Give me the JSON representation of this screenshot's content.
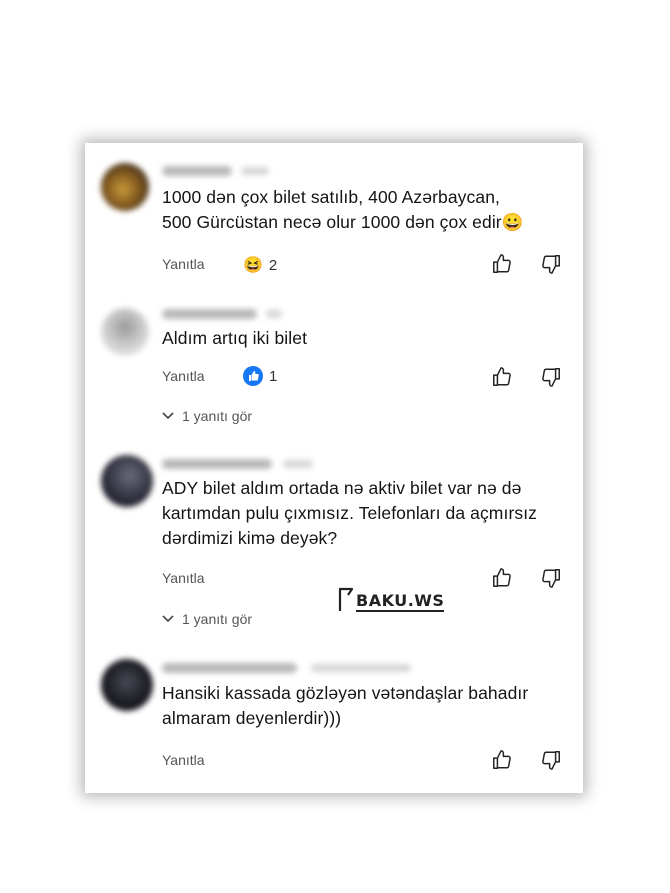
{
  "comments": [
    {
      "text_line1": "1000 dən çox bilet satılıb, 400 Azərbaycan,",
      "text_line2": "500 Gürcüstan necə olur 1000 dən çox edir",
      "emoji": "😀",
      "reply_label": "Yanıtla",
      "reaction_emoji": "😆",
      "reaction_count": "2"
    },
    {
      "text_line1": "Aldım artıq iki bilet",
      "reply_label": "Yanıtla",
      "reaction_count": "1",
      "view_replies": "1 yanıtı gör"
    },
    {
      "text_line1": "ADY bilet aldım ortada nə aktiv bilet var nə də",
      "text_line2": "kartımdan pulu çıxmısız. Telefonları da açmırsız",
      "text_line3": "dərdimizi kimə deyək?",
      "reply_label": "Yanıtla",
      "view_replies": "1 yanıtı gör"
    },
    {
      "text_line1": "Hansiki kassada gözləyən vətəndaşlar bahadır",
      "text_line2": "almaram deyenlerdir)))",
      "reply_label": "Yanıtla"
    }
  ],
  "watermark": {
    "text": "BAKU.WS"
  }
}
